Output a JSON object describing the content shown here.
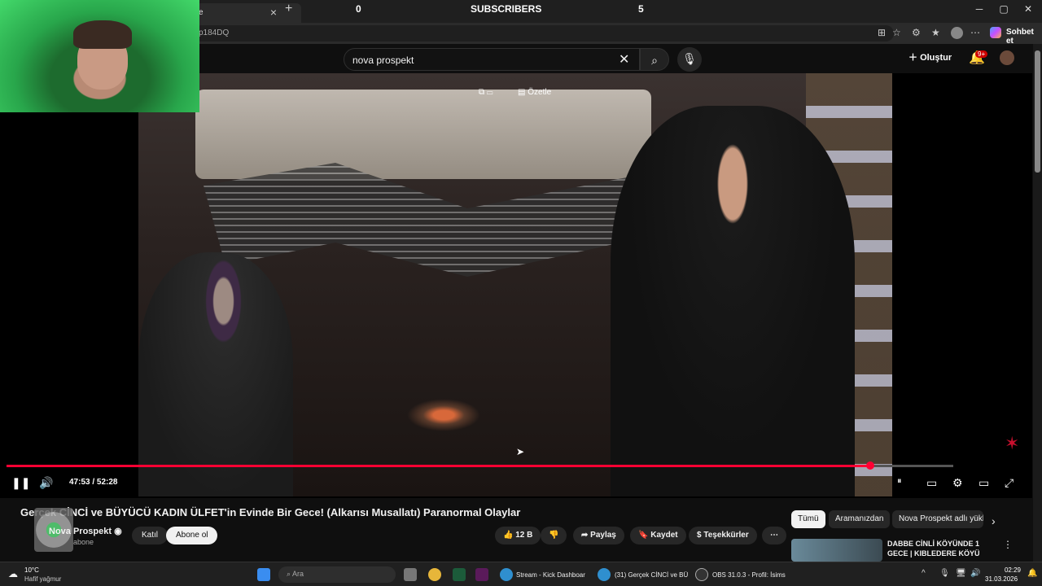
{
  "browser": {
    "tab_title": "e",
    "tab_close": "×",
    "tab_new": "+",
    "url": "p184DQ",
    "chat_label": "Sohbet et",
    "window": {
      "min": "─",
      "max": "▢",
      "close": "✕"
    }
  },
  "overlay": {
    "left_count": "0",
    "label": "SUBSCRIBERS",
    "right_count": "5"
  },
  "youtube": {
    "search_value": "nova prospekt",
    "search_clear": "✕",
    "create_label": "Oluştur",
    "notification_badge": "9+"
  },
  "player": {
    "summary_label": "Özetle",
    "time": "47:53 / 52:28",
    "progress": 0.9127
  },
  "video": {
    "title": "Gerçek CİNCİ ve BÜYÜCÜ KADIN ÜLFET'in Evinde Bir Gece! (Alkarısı Musallatı) Paranormal Olaylar",
    "channel": "Nova Prospekt",
    "subs": "abone",
    "join_label": "Katıl",
    "subscribe_label": "Abone ol",
    "likes": "12 B",
    "share_label": "Paylaş",
    "save_label": "Kaydet",
    "thanks_label": "Teşekkürler",
    "more_label": "⋯"
  },
  "recommendations": {
    "chips": [
      "Tümü",
      "Aramanızdan",
      "Nova Prospekt adlı yükle"
    ],
    "items": [
      {
        "title": "DABBE CİNLİ KÖYÜNDE 1 GECE | KIBLEDERE KÖYÜ"
      }
    ]
  },
  "taskbar": {
    "weather_temp": "10°C",
    "weather_desc": "Hafif yağmur",
    "search_placeholder": "Ara",
    "apps": [
      {
        "label": "Stream - Kick Dashboar"
      },
      {
        "label": "(31) Gerçek CİNCİ ve BÜ"
      },
      {
        "label": "OBS 31.0.3 - Profil: İsims"
      }
    ],
    "time": "02:29",
    "date": "31.03.2026"
  },
  "colors": {
    "accent": "#ff0033",
    "background": "#0f0f0f"
  }
}
